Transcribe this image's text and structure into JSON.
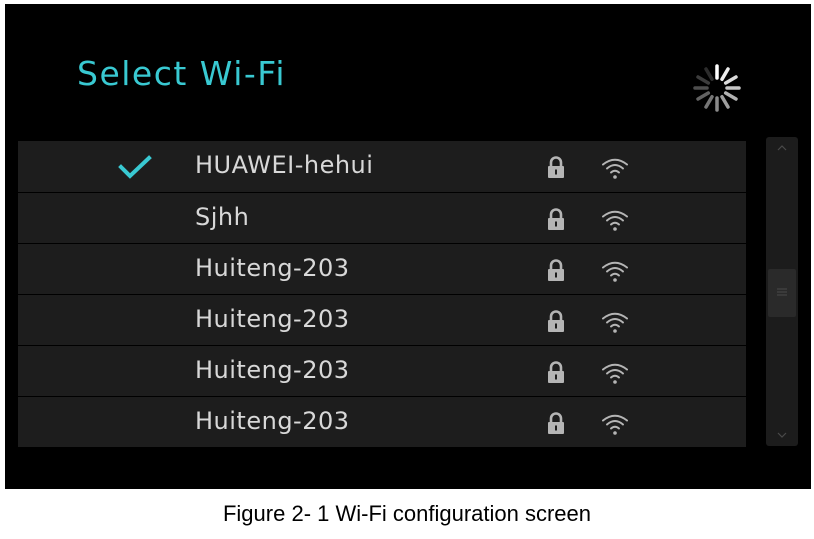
{
  "screen": {
    "title": "Select Wi-Fi",
    "accent_color": "#39c9d2",
    "loading_indicator": "spinner-icon",
    "networks": [
      {
        "ssid": "HUAWEI-hehui",
        "connected": true,
        "secured": true
      },
      {
        "ssid": "Sjhh",
        "connected": false,
        "secured": true
      },
      {
        "ssid": "Huiteng-203",
        "connected": false,
        "secured": true
      },
      {
        "ssid": "Huiteng-203",
        "connected": false,
        "secured": true
      },
      {
        "ssid": "Huiteng-203",
        "connected": false,
        "secured": true
      },
      {
        "ssid": "Huiteng-203",
        "connected": false,
        "secured": true
      }
    ]
  },
  "caption": "Figure 2- 1 Wi-Fi configuration screen"
}
